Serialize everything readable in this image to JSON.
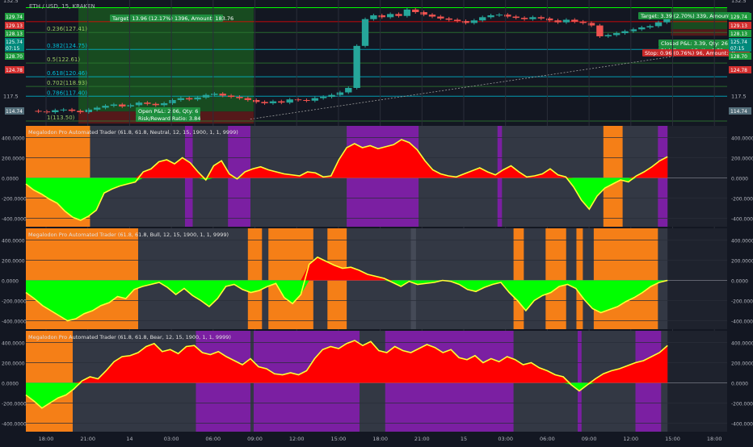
{
  "colors": {
    "background": "#131722",
    "panel_bg": "#1e222d",
    "grid": "#2a2e39",
    "axis_text": "#b2b5be",
    "orange": "#f57f17",
    "purple": "#7b1fa2",
    "gray_band": "#454a57",
    "green": "#00ff00",
    "red": "#ff0000",
    "yellow": "#ffff33",
    "candle_up": "#26a69a",
    "candle_down": "#ef5350",
    "profit_zone": "#1b5e20",
    "loss_zone": "#5d1a1a",
    "fib_line": "#2e7d32",
    "level_line": "#00bcd4"
  },
  "chart_data": [
    {
      "type": "candlestick",
      "title": "ETH / USD, 15, KRAKEN",
      "xlabel": "",
      "ylabel": "",
      "ylim": [
        113.0,
        132.5
      ],
      "y_ticks": [
        117.5,
        132.5
      ],
      "x_ticks": [
        "18:00",
        "21:00",
        "14",
        "03:00",
        "06:00",
        "09:00",
        "12:00",
        "15:00",
        "18:00",
        "21:00",
        "15",
        "03:00",
        "06:00",
        "09:00",
        "12:00",
        "15:00",
        "18:00"
      ],
      "price_badges": [
        {
          "value": "129.74",
          "color": "#1e9b3c"
        },
        {
          "value": "129.13",
          "color": "#d32f2f"
        },
        {
          "value": "128.13",
          "color": "#1e9b3c"
        },
        {
          "value": "07:15",
          "color": "#00897b"
        },
        {
          "value": "125.74",
          "color": "#00897b"
        },
        {
          "value": "128.70",
          "color": "#1e9b3c"
        },
        {
          "value": "124.78",
          "color": "#d32f2f"
        },
        {
          "value": "114.74",
          "color": "#546e7a"
        }
      ],
      "fib_levels": [
        {
          "label": "0.236(127.41)",
          "value": 127.41
        },
        {
          "label": "0.382(124.75)",
          "value": 124.75
        },
        {
          "label": "0.5(122.61)",
          "value": 122.61
        },
        {
          "label": "0.618(120.46)",
          "value": 120.46
        },
        {
          "label": "0.702(118.93)",
          "value": 118.93
        },
        {
          "label": "0.786(117.40)",
          "value": 117.4
        },
        {
          "label": "1(113.50)",
          "value": 113.5
        }
      ],
      "annotations": [
        {
          "text": "Target: 13.96 (12.17%) 1396, Amount: 183.76",
          "kind": "target"
        },
        {
          "text": "Open P&L: 2.06, Qty: 6",
          "kind": "pnl"
        },
        {
          "text": "Risk/Reward Ratio: 3.84",
          "kind": "pnl"
        },
        {
          "text": "Target: 3.39 (2.70%) 339, Amount: 1",
          "kind": "target"
        },
        {
          "text": "Closed P&L: 3.39, Qty: 26",
          "kind": "pnl"
        },
        {
          "text": "Risk/Reward Ratio: 3.52",
          "kind": "pnl"
        },
        {
          "text": "Stop: 0.96 (0.76%) 96, Amount: 75",
          "kind": "stop"
        }
      ],
      "series": [
        {
          "values": [
            115.1,
            115.0,
            114.9,
            115.2,
            115.3,
            115.1,
            114.9,
            115.3,
            115.6,
            115.9,
            116.1,
            115.8,
            116.0,
            116.4,
            116.2,
            116.0,
            116.3,
            116.8,
            117.1,
            116.9,
            117.2,
            117.6,
            117.8,
            117.5,
            117.3,
            117.1,
            116.8,
            116.5,
            116.3,
            116.6,
            116.4,
            116.9,
            116.8,
            116.7,
            117.1,
            117.3,
            117.6,
            118.0,
            118.7,
            125.3,
            129.5,
            130.1,
            129.8,
            130.3,
            130.0,
            131.0,
            130.6,
            130.2,
            129.9,
            129.6,
            129.4,
            129.2,
            128.9,
            129.3,
            129.8,
            130.1,
            130.2,
            129.9,
            129.7,
            129.5,
            129.8,
            129.6,
            129.3,
            129.0,
            129.4,
            129.1,
            128.9,
            128.5,
            126.8,
            127.0,
            127.3,
            127.6,
            127.9,
            128.2,
            128.4,
            129.0,
            129.6
          ]
        }
      ]
    },
    {
      "type": "area",
      "title": "Megalodon Pro Automated Trader (61.8, 61.8, Neutral, 12, 15, 1900, 1, 1, 9999)",
      "xlabel": "",
      "ylabel": "",
      "ylim": [
        -500,
        500
      ],
      "y_ticks": [
        400,
        200,
        0,
        -200,
        -400
      ],
      "background_bands": [
        {
          "from": 0,
          "to": 0.1,
          "color": "orange"
        },
        {
          "from": 0.248,
          "to": 0.26,
          "color": "purple"
        },
        {
          "from": 0.315,
          "to": 0.35,
          "color": "purple"
        },
        {
          "from": 0.5,
          "to": 0.612,
          "color": "purple"
        },
        {
          "from": 0.735,
          "to": 0.742,
          "color": "purple"
        },
        {
          "from": 0.9,
          "to": 0.93,
          "color": "orange"
        },
        {
          "from": 0.985,
          "to": 1.0,
          "color": "purple"
        }
      ],
      "series": [
        {
          "name": "",
          "values": [
            -60,
            -120,
            -160,
            -210,
            -250,
            -330,
            -390,
            -420,
            -380,
            -320,
            -150,
            -110,
            -80,
            -60,
            -40,
            60,
            90,
            160,
            180,
            140,
            200,
            150,
            60,
            -20,
            120,
            170,
            40,
            -10,
            60,
            90,
            110,
            80,
            60,
            40,
            30,
            20,
            60,
            50,
            10,
            20,
            180,
            300,
            340,
            300,
            320,
            290,
            310,
            330,
            380,
            350,
            280,
            170,
            80,
            40,
            20,
            10,
            40,
            70,
            100,
            60,
            30,
            80,
            120,
            60,
            10,
            20,
            40,
            90,
            30,
            10,
            -90,
            -220,
            -310,
            -180,
            -100,
            -60,
            -20,
            -40,
            20,
            60,
            110,
            170,
            210
          ]
        }
      ]
    },
    {
      "type": "area",
      "title": "Megalodon Pro Automated Trader (61.8, 61.8, Bull, 12, 15, 1900, 1, 1, 9999)",
      "xlabel": "",
      "ylabel": "",
      "ylim": [
        -500,
        500
      ],
      "y_ticks": [
        400,
        200,
        0,
        -200,
        -400
      ],
      "background_bands": [
        {
          "from": 0,
          "to": 0.175,
          "color": "orange"
        },
        {
          "from": 0.346,
          "to": 0.368,
          "color": "orange"
        },
        {
          "from": 0.378,
          "to": 0.448,
          "color": "orange"
        },
        {
          "from": 0.47,
          "to": 0.5,
          "color": "orange"
        },
        {
          "from": 0.6,
          "to": 0.608,
          "color": "gray"
        },
        {
          "from": 0.76,
          "to": 0.776,
          "color": "orange"
        },
        {
          "from": 0.81,
          "to": 0.842,
          "color": "orange"
        },
        {
          "from": 0.858,
          "to": 0.868,
          "color": "orange"
        },
        {
          "from": 0.885,
          "to": 0.985,
          "color": "orange"
        }
      ],
      "series": [
        {
          "name": "",
          "values": [
            -120,
            -180,
            -250,
            -300,
            -350,
            -400,
            -380,
            -330,
            -300,
            -250,
            -220,
            -160,
            -180,
            -90,
            -60,
            -40,
            -20,
            -70,
            -140,
            -80,
            -150,
            -200,
            -260,
            -180,
            -60,
            -40,
            -90,
            -120,
            -100,
            -60,
            -30,
            -170,
            -230,
            -140,
            160,
            230,
            190,
            150,
            120,
            130,
            100,
            60,
            40,
            20,
            -20,
            -60,
            -10,
            -40,
            -30,
            -20,
            0,
            -10,
            -40,
            -90,
            -110,
            -70,
            -40,
            -20,
            -120,
            -200,
            -300,
            -200,
            -150,
            -120,
            -60,
            -40,
            -80,
            -190,
            -280,
            -320,
            -290,
            -260,
            -210,
            -170,
            -120,
            -60,
            -20,
            0
          ]
        }
      ]
    },
    {
      "type": "area",
      "title": "Megalodon Pro Automated Trader (61.8, 61.8, Bear, 12, 15, 1900, 1, 1, 9999)",
      "xlabel": "",
      "ylabel": "",
      "ylim": [
        -500,
        500
      ],
      "y_ticks": [
        400,
        200,
        0,
        -200,
        -400
      ],
      "background_bands": [
        {
          "from": 0,
          "to": 0.073,
          "color": "orange"
        },
        {
          "from": 0.265,
          "to": 0.35,
          "color": "purple"
        },
        {
          "from": 0.355,
          "to": 0.52,
          "color": "purple"
        },
        {
          "from": 0.56,
          "to": 0.76,
          "color": "purple"
        },
        {
          "from": 0.86,
          "to": 0.866,
          "color": "purple"
        },
        {
          "from": 0.95,
          "to": 0.99,
          "color": "purple"
        }
      ],
      "series": [
        {
          "name": "",
          "values": [
            -120,
            -180,
            -250,
            -200,
            -150,
            -120,
            -60,
            20,
            60,
            40,
            120,
            210,
            260,
            270,
            300,
            360,
            390,
            310,
            330,
            290,
            360,
            370,
            300,
            280,
            310,
            260,
            220,
            180,
            240,
            160,
            140,
            90,
            80,
            100,
            80,
            120,
            240,
            330,
            360,
            340,
            390,
            420,
            370,
            410,
            320,
            300,
            360,
            320,
            300,
            340,
            380,
            350,
            300,
            330,
            250,
            230,
            270,
            200,
            240,
            210,
            260,
            230,
            180,
            200,
            150,
            120,
            80,
            60,
            -20,
            -80,
            -20,
            40,
            90,
            120,
            140,
            170,
            200,
            220,
            260,
            300,
            370
          ]
        }
      ]
    }
  ]
}
